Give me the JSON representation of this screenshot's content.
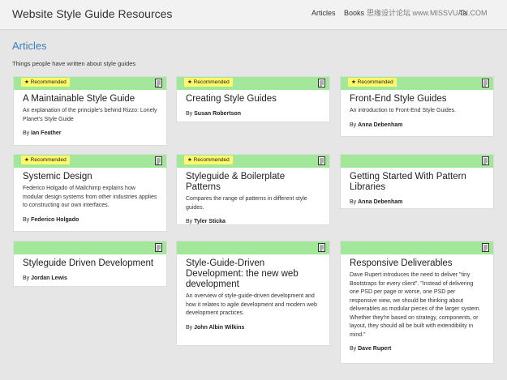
{
  "header": {
    "site_title": "Website Style Guide Resources",
    "nav": [
      "Articles",
      "Books",
      "Ta"
    ],
    "watermark": "思缘设计论坛 www.MISSVUAN.COM"
  },
  "main": {
    "heading": "Articles",
    "subtitle": "Things people have written about style guides"
  },
  "badge_label": "★ Recommended",
  "by_label": "By",
  "articles": [
    {
      "title": "A Maintainable Style Guide",
      "description": "An explanation of the principle's behind Rizzo: Lonely Planet's Style Guide",
      "author": "Ian Feather",
      "recommended": true
    },
    {
      "title": "Creating Style Guides",
      "description": "",
      "author": "Susan Robertson",
      "recommended": true
    },
    {
      "title": "Front-End Style Guides",
      "description": "An introduction to Front-End Style Guides.",
      "author": "Anna Debenham",
      "recommended": true
    },
    {
      "title": "Systemic Design",
      "description": "Federico Holgado of Mailchimp explains how modular design systems from other industries applies to constructing our own interfaces.",
      "author": "Federico Holgado",
      "recommended": true
    },
    {
      "title": "Styleguide & Boilerplate Patterns",
      "description": "Compares the range of patterns in different style guides.",
      "author": "Tyler Sticka",
      "recommended": true
    },
    {
      "title": "Getting Started With Pattern Libraries",
      "description": "",
      "author": "Anna Debenham",
      "recommended": false
    },
    {
      "title": "Styleguide Driven Development",
      "description": "",
      "author": "Jordan Lewis",
      "recommended": false
    },
    {
      "title": "Style-Guide-Driven Development: the new web development",
      "description": "An overview of style-guide-driven development and how it relates to agile development and modern web development practices.",
      "author": "John Albin Wilkins",
      "recommended": false
    },
    {
      "title": "Responsive Deliverables",
      "description": "Dave Rupert introduces the need to deliver \"tiny Bootstraps for every client\". \"Instead of delivering one PSD per page or worse, one PSD per responsive view, we should be thinking about deliverables as modular pieces of the larger system. Whether they're based on strategy, components, or layout, they should all be built with extendibility in mind.\"",
      "author": "Dave Rupert",
      "recommended": false
    }
  ],
  "colors": {
    "card_header": "#a3e89a",
    "badge": "#fff86a",
    "heading": "#3a7fbf",
    "background": "#e6e6e6"
  }
}
